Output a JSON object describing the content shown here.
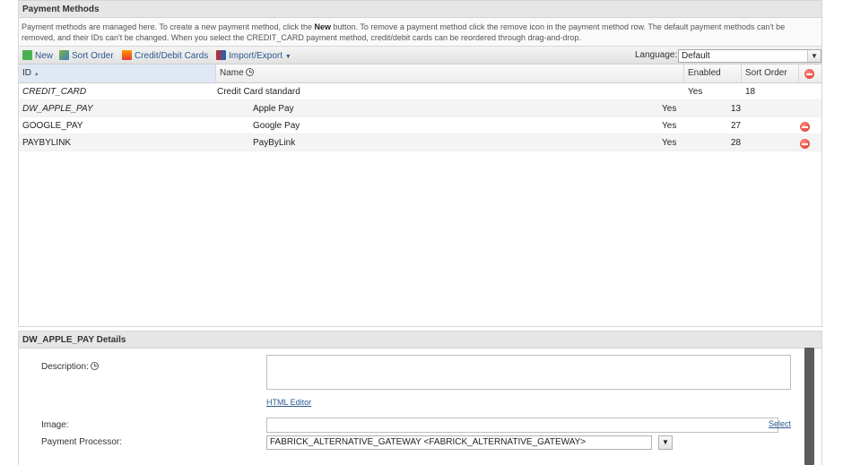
{
  "panel": {
    "title": "Payment Methods",
    "description_part1": "Payment methods are managed here. To create a new payment method, click the ",
    "description_bold": "New",
    "description_part2": " button. To remove a payment method click the remove icon in the payment method row. The default payment methods can't be removed, and their IDs can't be changed. When you select the CREDIT_CARD payment method, credit/debit cards can be reordered through drag-and-drop."
  },
  "toolbar": {
    "new_label": "New",
    "sort_order_label": "Sort Order",
    "cards_label": "Credit/Debit Cards",
    "import_export_label": "Import/Export",
    "language_label": "Language:",
    "language_value": "Default"
  },
  "grid": {
    "columns": {
      "id": "ID",
      "name": "Name",
      "enabled": "Enabled",
      "sort_order": "Sort Order"
    },
    "rows": [
      {
        "id": "CREDIT_CARD",
        "name": "Credit Card standard",
        "enabled": "Yes",
        "sort_order": "18",
        "removable": false,
        "italic": true
      },
      {
        "id": "DW_APPLE_PAY",
        "name": "Apple Pay",
        "enabled": "Yes",
        "sort_order": "13",
        "removable": false,
        "italic": true
      },
      {
        "id": "GOOGLE_PAY",
        "name": "Google Pay",
        "enabled": "Yes",
        "sort_order": "27",
        "removable": true,
        "italic": false
      },
      {
        "id": "PAYBYLINK",
        "name": "PayByLink",
        "enabled": "Yes",
        "sort_order": "28",
        "removable": true,
        "italic": false
      }
    ]
  },
  "details": {
    "title": "DW_APPLE_PAY Details",
    "description_label": "Description:",
    "html_editor_link": "HTML Editor",
    "image_label": "Image:",
    "select_link": "Select",
    "processor_label": "Payment Processor:",
    "processor_value": "FABRICK_ALTERNATIVE_GATEWAY <FABRICK_ALTERNATIVE_GATEWAY>"
  },
  "colors": {
    "link": "#2b5a8f",
    "remove": "#d93025",
    "header_bg": "#e6e6e6"
  }
}
